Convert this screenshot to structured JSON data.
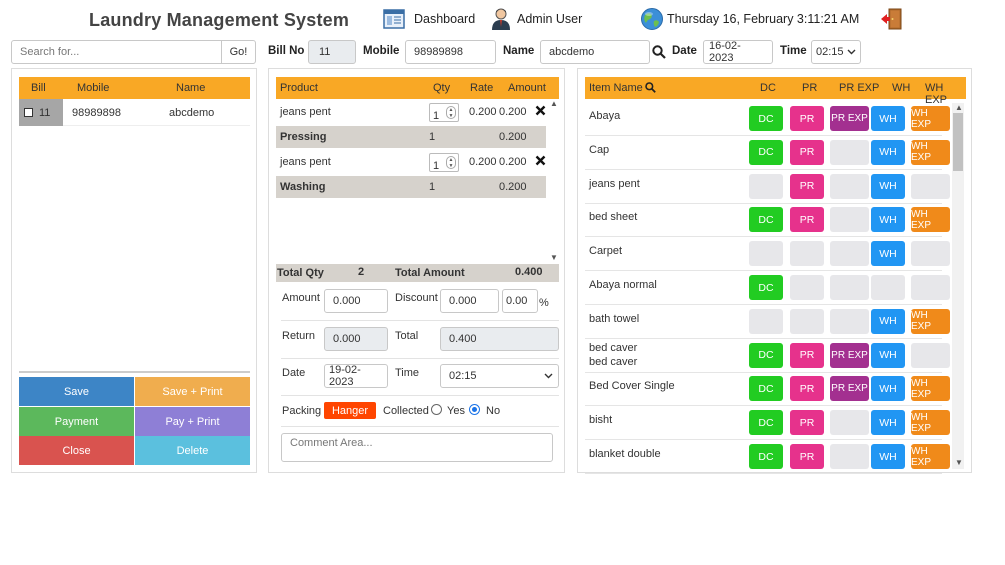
{
  "header": {
    "title": "Laundry Management System",
    "dashboard": "Dashboard",
    "user": "Admin User",
    "datetime": "Thursday 16, February 3:11:21 AM"
  },
  "topbar": {
    "search_placeholder": "Search for...",
    "go": "Go!",
    "bill_no_label": "Bill No",
    "bill_no": "11",
    "mobile_label": "Mobile",
    "mobile": "98989898",
    "name_label": "Name",
    "name": "abcdemo",
    "date_label": "Date",
    "date": "16-02-2023",
    "time_label": "Time",
    "time": "02:15"
  },
  "bills": {
    "headers": [
      "Bill",
      "Mobile",
      "Name"
    ],
    "rows": [
      {
        "bill": "11",
        "mobile": "98989898",
        "name": "abcdemo"
      }
    ]
  },
  "actions": {
    "save": "Save",
    "save_print": "Save + Print",
    "payment": "Payment",
    "pay_print": "Pay + Print",
    "close": "Close",
    "delete": "Delete"
  },
  "products": {
    "headers": [
      "Product",
      "Qty",
      "Rate",
      "Amount"
    ],
    "items": [
      {
        "name": "jeans pent",
        "qty": "1",
        "rate": "0.200",
        "amount": "0.200",
        "service": "Pressing",
        "service_qty": "1",
        "service_amount": "0.200"
      },
      {
        "name": "jeans pent",
        "qty": "1",
        "rate": "0.200",
        "amount": "0.200",
        "service": "Washing",
        "service_qty": "1",
        "service_amount": "0.200"
      }
    ],
    "total_qty_label": "Total Qty",
    "total_qty": "2",
    "total_amount_label": "Total Amount",
    "total_amount": "0.400"
  },
  "payment": {
    "amount_label": "Amount",
    "amount": "0.000",
    "discount_label": "Discount",
    "discount": "0.000",
    "discount_pct": "0.00",
    "pct": "%",
    "return_label": "Return",
    "return": "0.000",
    "total_label": "Total",
    "total": "0.400",
    "date_label": "Date",
    "date": "19-02-2023",
    "time_label": "Time",
    "time": "02:15",
    "packing_label": "Packing",
    "packing": "Hanger",
    "collected_label": "Collected",
    "yes": "Yes",
    "no": "No",
    "comment_placeholder": "Comment Area..."
  },
  "items_grid": {
    "headers": [
      "Item Name",
      "DC",
      "PR",
      "PR EXP",
      "WH",
      "WH EXP"
    ],
    "rows": [
      {
        "name": "Abaya",
        "dc": "DC",
        "pr": "PR",
        "prx": "PR EXP",
        "wh": "WH",
        "whx": "WH EXP"
      },
      {
        "name": "Cap",
        "dc": "DC",
        "pr": "PR",
        "prx": "",
        "wh": "WH",
        "whx": "WH EXP"
      },
      {
        "name": "jeans pent",
        "dc": "",
        "pr": "PR",
        "prx": "",
        "wh": "WH",
        "whx": ""
      },
      {
        "name": "bed sheet",
        "dc": "DC",
        "pr": "PR",
        "prx": "",
        "wh": "WH",
        "whx": "WH EXP"
      },
      {
        "name": "Carpet",
        "dc": "",
        "pr": "",
        "prx": "",
        "wh": "WH",
        "whx": ""
      },
      {
        "name": "Abaya normal",
        "dc": "DC",
        "pr": "",
        "prx": "",
        "wh": "",
        "whx": ""
      },
      {
        "name": "bath towel",
        "dc": "",
        "pr": "",
        "prx": "",
        "wh": "WH",
        "whx": "WH EXP"
      },
      {
        "name": "bed caver",
        "name2": "bed caver",
        "dc": "DC",
        "pr": "PR",
        "prx": "PR EXP",
        "wh": "WH",
        "whx": ""
      },
      {
        "name": "Bed Cover Single",
        "dc": "DC",
        "pr": "PR",
        "prx": "PR EXP",
        "wh": "WH",
        "whx": "WH EXP"
      },
      {
        "name": "bisht",
        "dc": "DC",
        "pr": "PR",
        "prx": "",
        "wh": "WH",
        "whx": "WH EXP"
      },
      {
        "name": "blanket double",
        "dc": "DC",
        "pr": "PR",
        "prx": "",
        "wh": "WH",
        "whx": "WH EXP"
      }
    ]
  },
  "colors": {
    "table_header": "#f9a825",
    "save": "#3d85c6",
    "save_print": "#f0ad4e",
    "payment": "#5cb85c",
    "pay_print": "#8e7fd6",
    "close": "#d9534f",
    "delete": "#5bc0de",
    "dc": "#22cc22",
    "pr": "#e6328c",
    "pr_exp": "#a33090",
    "wh": "#2196f3",
    "wh_exp": "#f08a1a",
    "hanger": "#ff4500"
  },
  "icons": [
    "dashboard-icon",
    "user-icon",
    "globe-icon",
    "logout-icon",
    "search-icon",
    "delete-x-icon"
  ]
}
